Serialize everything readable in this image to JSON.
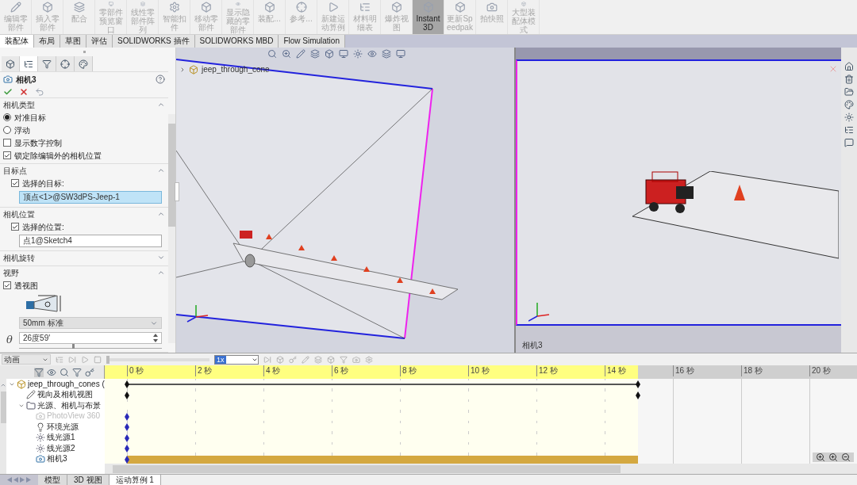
{
  "toolbar": {
    "items": [
      {
        "label": "编辑零部件",
        "selected": false
      },
      {
        "label": "插入零部件",
        "selected": false
      },
      {
        "label": "配合",
        "selected": false
      },
      {
        "label": "零部件预览窗口",
        "selected": false
      },
      {
        "label": "线性零部件阵列",
        "selected": false
      },
      {
        "label": "智能扣件",
        "selected": false
      },
      {
        "label": "移动零部件",
        "selected": false
      },
      {
        "label": "显示隐藏的零部件",
        "selected": false
      },
      {
        "label": "装配...",
        "selected": false
      },
      {
        "label": "参考...",
        "selected": false
      },
      {
        "label": "新建运动算例",
        "selected": false
      },
      {
        "label": "材料明细表",
        "selected": false
      },
      {
        "label": "爆炸视图",
        "selected": false
      },
      {
        "label": "Instant3D",
        "selected": true
      },
      {
        "label": "更新Speedpak",
        "selected": false
      },
      {
        "label": "拍快照",
        "selected": false
      },
      {
        "label": "大型装配体模式",
        "selected": false
      }
    ]
  },
  "ribbon_tabs": [
    {
      "label": "装配体",
      "selected": true
    },
    {
      "label": "布局",
      "selected": false
    },
    {
      "label": "草图",
      "selected": false
    },
    {
      "label": "评估",
      "selected": false
    },
    {
      "label": "SOLIDWORKS 插件",
      "selected": false
    },
    {
      "label": "SOLIDWORKS MBD",
      "selected": false
    },
    {
      "label": "Flow Simulation",
      "selected": false
    }
  ],
  "property_manager": {
    "title": "相机3",
    "sections": [
      {
        "title": "相机类型",
        "expanded": true,
        "rows": [
          {
            "kind": "radio",
            "label": "对准目标",
            "selected": true
          },
          {
            "kind": "radio",
            "label": "浮动",
            "selected": false
          },
          {
            "kind": "checkbox",
            "label": "显示数字控制",
            "checked": false
          },
          {
            "kind": "checkbox",
            "label": "锁定除编辑外的相机位置",
            "checked": true
          }
        ]
      },
      {
        "title": "目标点",
        "expanded": true,
        "rows": [
          {
            "kind": "sub_checkbox",
            "label": "选择的目标:",
            "checked": true
          },
          {
            "kind": "field",
            "value": "顶点<1>@SW3dPS-Jeep-1",
            "selected": true
          }
        ]
      },
      {
        "title": "相机位置",
        "expanded": true,
        "rows": [
          {
            "kind": "sub_checkbox",
            "label": "选择的位置:",
            "checked": true
          },
          {
            "kind": "field",
            "value": "点1@Sketch4",
            "selected": false
          }
        ]
      },
      {
        "title": "相机旋转",
        "expanded": false
      },
      {
        "title": "视野",
        "expanded": true,
        "rows": [
          {
            "kind": "checkbox",
            "label": "透视图",
            "checked": true
          },
          {
            "kind": "diagram"
          },
          {
            "kind": "select",
            "value": "50mm 标准"
          },
          {
            "kind": "angle",
            "symbol": "θ",
            "value": "26度59'",
            "level": 0.37
          }
        ]
      }
    ]
  },
  "viewports": {
    "main": {
      "tree_label": "jeep_through_cone"
    },
    "camera": {
      "label": "相机3"
    }
  },
  "motion_study": {
    "mode": "动画",
    "speed": "1x",
    "playback": {
      "level": 0
    },
    "ticks": [
      "0 秒",
      "2 秒",
      "4 秒",
      "6 秒",
      "8 秒",
      "10 秒",
      "12 秒",
      "14 秒",
      "16 秒",
      "18 秒",
      "20 秒"
    ],
    "tree": [
      {
        "label": "jeep_through_cones (",
        "kind": "assembly",
        "expanded": true,
        "disabled": false,
        "start_key": true,
        "end_key": true,
        "color": "#111111",
        "bar": false,
        "children": [
          {
            "label": "视向及相机视图",
            "kind": "view",
            "disabled": false,
            "start_key": true,
            "end_key": true,
            "color": "#111111",
            "bar": false
          },
          {
            "label": "光源、相机与布景",
            "kind": "folder",
            "expanded": true,
            "disabled": false,
            "start_key": false,
            "end_key": false,
            "bar": false,
            "children": [
              {
                "label": "PhotoView 360",
                "kind": "photoview",
                "disabled": true,
                "start_key": true,
                "end_key": false,
                "color": "#2a2ab8",
                "bar": false
              },
              {
                "label": "环境光源",
                "kind": "bulb",
                "disabled": false,
                "start_key": true,
                "end_key": false,
                "color": "#2a2ab8",
                "bar": false
              },
              {
                "label": "线光源1",
                "kind": "light",
                "disabled": false,
                "start_key": true,
                "end_key": false,
                "color": "#2a2ab8",
                "bar": false
              },
              {
                "label": "线光源2",
                "kind": "light",
                "disabled": false,
                "start_key": true,
                "end_key": false,
                "color": "#2a2ab8",
                "bar": false
              },
              {
                "label": "相机3",
                "kind": "camera",
                "disabled": false,
                "start_key": true,
                "end_key": false,
                "color": "#2a2ab8",
                "bar": true
              }
            ]
          }
        ]
      }
    ],
    "tabs": [
      {
        "label": "模型",
        "selected": false
      },
      {
        "label": "3D 视图",
        "selected": false
      },
      {
        "label": "运动算例 1",
        "selected": true
      }
    ]
  }
}
